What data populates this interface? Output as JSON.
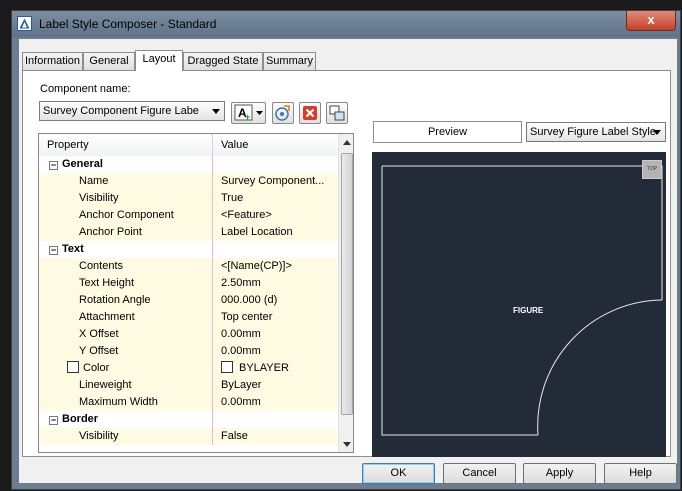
{
  "window": {
    "title": "Label Style Composer - Standard",
    "close_glyph": "x"
  },
  "tabs": [
    "Information",
    "General",
    "Layout",
    "Dragged State",
    "Summary"
  ],
  "active_tab": "Layout",
  "component": {
    "label": "Component name:",
    "selected": "Survey Component Figure Labe"
  },
  "toolbar": {
    "add_icon": "add-component-icon",
    "copy_icon": "copy-component-icon",
    "delete_icon": "delete-component-icon",
    "draw_order_icon": "draw-order-icon",
    "add_text": "A",
    "add_plus": "+"
  },
  "grid": {
    "headers": {
      "property": "Property",
      "value": "Value"
    },
    "rows": [
      {
        "type": "category",
        "label": "General",
        "expander": "⊟"
      },
      {
        "type": "property",
        "label": "Name",
        "value": "Survey Component..."
      },
      {
        "type": "property",
        "label": "Visibility",
        "value": "True"
      },
      {
        "type": "property",
        "label": "Anchor Component",
        "value": "<Feature>"
      },
      {
        "type": "property",
        "label": "Anchor Point",
        "value": "Label Location"
      },
      {
        "type": "category",
        "label": "Text",
        "expander": "⊟"
      },
      {
        "type": "property",
        "label": "Contents",
        "value": "<[Name(CP)]>"
      },
      {
        "type": "property",
        "label": "Text Height",
        "value": "2.50mm"
      },
      {
        "type": "property",
        "label": "Rotation Angle",
        "value": "000.000 (d)"
      },
      {
        "type": "property",
        "label": "Attachment",
        "value": "Top center"
      },
      {
        "type": "property",
        "label": "X Offset",
        "value": "0.00mm"
      },
      {
        "type": "property",
        "label": "Y Offset",
        "value": "0.00mm"
      },
      {
        "type": "property-check",
        "label": "Color",
        "value": "BYLAYER"
      },
      {
        "type": "property",
        "label": "Lineweight",
        "value": "ByLayer"
      },
      {
        "type": "property",
        "label": "Maximum Width",
        "value": "0.00mm"
      },
      {
        "type": "category",
        "label": "Border",
        "expander": "⊟"
      },
      {
        "type": "property",
        "label": "Visibility",
        "value": "False"
      }
    ]
  },
  "preview": {
    "label": "Preview",
    "style_selected": "Survey Figure Label Style",
    "figure_text": "FIGURE",
    "top_button": "TOP",
    "background": "#222b37"
  },
  "buttons": {
    "ok": "OK",
    "cancel": "Cancel",
    "apply": "Apply",
    "help": "Help"
  }
}
